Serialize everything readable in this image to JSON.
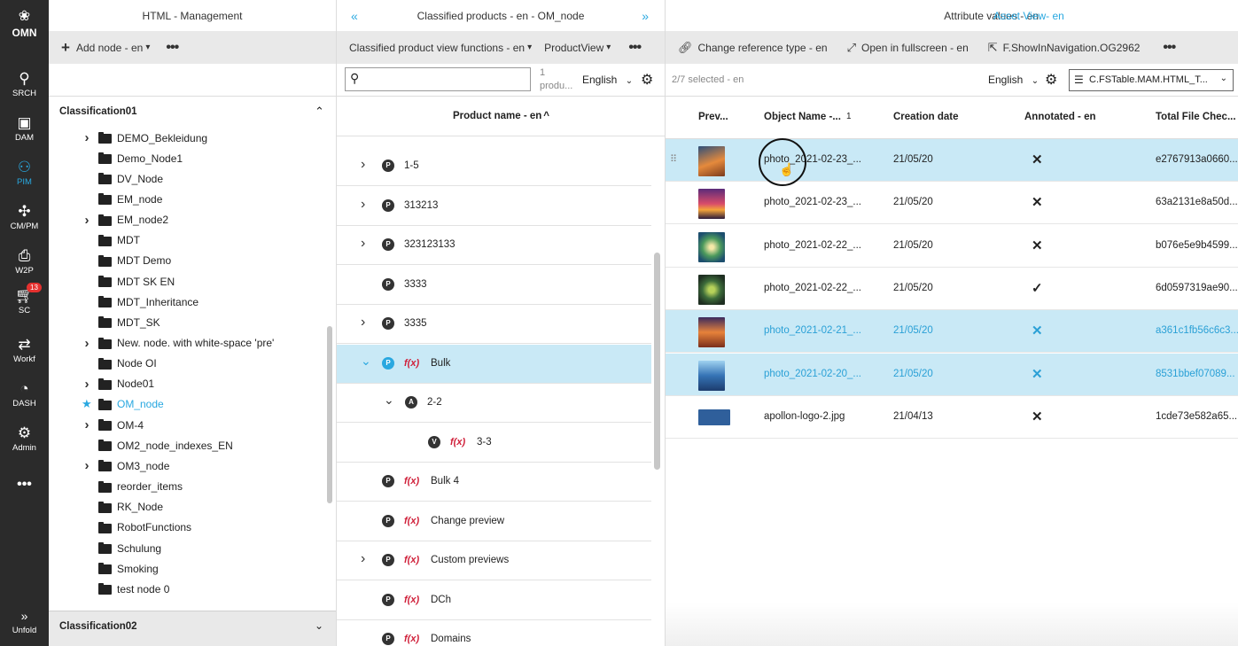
{
  "nav": {
    "logo": "OMN",
    "items": [
      {
        "label": "SRCH",
        "icon": "search-icon"
      },
      {
        "label": "DAM",
        "icon": "images-icon"
      },
      {
        "label": "PIM",
        "icon": "pim-icon"
      },
      {
        "label": "CM/PM",
        "icon": "network-icon"
      },
      {
        "label": "W2P",
        "icon": "print-icon"
      },
      {
        "label": "SC",
        "icon": "cart-icon",
        "badge": "13"
      },
      {
        "label": "Workf",
        "icon": "workflow-icon"
      },
      {
        "label": "DASH",
        "icon": "dashboard-icon"
      },
      {
        "label": "Admin",
        "icon": "gear-icon"
      }
    ],
    "more": "•••",
    "unfold": "Unfold"
  },
  "panel1": {
    "title": "HTML - Management",
    "add_node": "Add node - en",
    "section1": "Classification01",
    "section2": "Classification02",
    "nodes": [
      {
        "label": "DEMO_Bekleidung",
        "expand": true
      },
      {
        "label": "Demo_Node1",
        "expand": false
      },
      {
        "label": "DV_Node",
        "expand": false
      },
      {
        "label": "EM_node",
        "expand": false
      },
      {
        "label": "EM_node2",
        "expand": true
      },
      {
        "label": "MDT",
        "expand": false
      },
      {
        "label": "MDT Demo",
        "expand": false
      },
      {
        "label": "MDT SK EN",
        "expand": false
      },
      {
        "label": "MDT_Inheritance",
        "expand": false
      },
      {
        "label": "MDT_SK",
        "expand": false
      },
      {
        "label": "New.    node.    with white-space 'pre'",
        "expand": true
      },
      {
        "label": "Node OI",
        "expand": false
      },
      {
        "label": "Node01",
        "expand": true
      },
      {
        "label": "OM_node",
        "expand": false,
        "active": true
      },
      {
        "label": "OM-4",
        "expand": true
      },
      {
        "label": "OM2_node_indexes_EN",
        "expand": false
      },
      {
        "label": "OM3_node",
        "expand": true
      },
      {
        "label": "reorder_items",
        "expand": false
      },
      {
        "label": "RK_Node",
        "expand": false
      },
      {
        "label": "RobotFunctions",
        "expand": false
      },
      {
        "label": "Schulung",
        "expand": false
      },
      {
        "label": "Smoking",
        "expand": false
      },
      {
        "label": "test    node     0",
        "expand": false
      }
    ]
  },
  "panel2": {
    "title": "Classified products - en - OM_node",
    "view_functions": "Classified product view functions - en",
    "view": "ProductView",
    "count": "1",
    "count_unit": "produ...",
    "language": "English",
    "column": "Product name - en",
    "rows": [
      {
        "label": "1-5",
        "type": "P",
        "chev": "›",
        "fx": false,
        "indent": 0
      },
      {
        "label": "313213",
        "type": "P",
        "chev": "›",
        "fx": false,
        "indent": 0
      },
      {
        "label": "323123133",
        "type": "P",
        "chev": "›",
        "fx": false,
        "indent": 0
      },
      {
        "label": "3333",
        "type": "P",
        "chev": "",
        "fx": false,
        "indent": 0
      },
      {
        "label": "3335",
        "type": "P",
        "chev": "›",
        "fx": false,
        "indent": 0
      },
      {
        "label": "Bulk",
        "type": "P",
        "chev": "⌄",
        "fx": true,
        "indent": 0,
        "selected": true
      },
      {
        "label": "2-2",
        "type": "A",
        "chev": "⌄",
        "fx": false,
        "indent": 1
      },
      {
        "label": "3-3",
        "type": "V",
        "chev": "",
        "fx": true,
        "indent": 2
      },
      {
        "label": "Bulk 4",
        "type": "P",
        "chev": "",
        "fx": true,
        "indent": 0
      },
      {
        "label": "Change preview",
        "type": "P",
        "chev": "",
        "fx": true,
        "indent": 0
      },
      {
        "label": "Custom previews",
        "type": "P",
        "chev": "›",
        "fx": true,
        "indent": 0
      },
      {
        "label": "DCh",
        "type": "P",
        "chev": "",
        "fx": true,
        "indent": 0
      },
      {
        "label": "Domains",
        "type": "P",
        "chev": "",
        "fx": true,
        "indent": 0
      }
    ]
  },
  "panel3": {
    "tab_attr": "Attribute values - en",
    "tab_asset": "Asset View- en",
    "change_ref": "Change reference type - en",
    "fullscreen": "Open in fullscreen - en",
    "show_nav": "F.ShowInNavigation.OG2962",
    "selected": "2/7 selected - en",
    "language": "English",
    "table_select": "C.FSTable.MAM.HTML_T...",
    "columns": [
      "Prev...",
      "Object Name -...",
      "Creation date",
      "Annotated - en",
      "Total File Chec..."
    ],
    "sort_indicator": "1",
    "rows": [
      {
        "name": "photo_2021-02-23_...",
        "date": "21/05/20",
        "annotated": "✕",
        "checksum": "e2767913a0660...",
        "thumb": "sunset-1",
        "state": "hover"
      },
      {
        "name": "photo_2021-02-23_...",
        "date": "21/05/20",
        "annotated": "✕",
        "checksum": "63a2131e8a50d...",
        "thumb": "sunset-2",
        "state": ""
      },
      {
        "name": "photo_2021-02-22_...",
        "date": "21/05/20",
        "annotated": "✕",
        "checksum": "b076e5e9b4599...",
        "thumb": "tunnel",
        "state": ""
      },
      {
        "name": "photo_2021-02-22_...",
        "date": "21/05/20",
        "annotated": "✓",
        "checksum": "6d0597319ae90...",
        "thumb": "spiral",
        "state": ""
      },
      {
        "name": "photo_2021-02-21_...",
        "date": "21/05/20",
        "annotated": "✕",
        "checksum": "a361c1fb56c6c3...",
        "thumb": "sunset-3",
        "state": "selected"
      },
      {
        "name": "photo_2021-02-20_...",
        "date": "21/05/20",
        "annotated": "✕",
        "checksum": "8531bbef07089...",
        "thumb": "forest",
        "state": "selected"
      },
      {
        "name": "apollon-logo-2.jpg",
        "date": "21/04/13",
        "annotated": "✕",
        "checksum": "1cde73e582a65...",
        "thumb": "logo",
        "state": ""
      }
    ]
  }
}
